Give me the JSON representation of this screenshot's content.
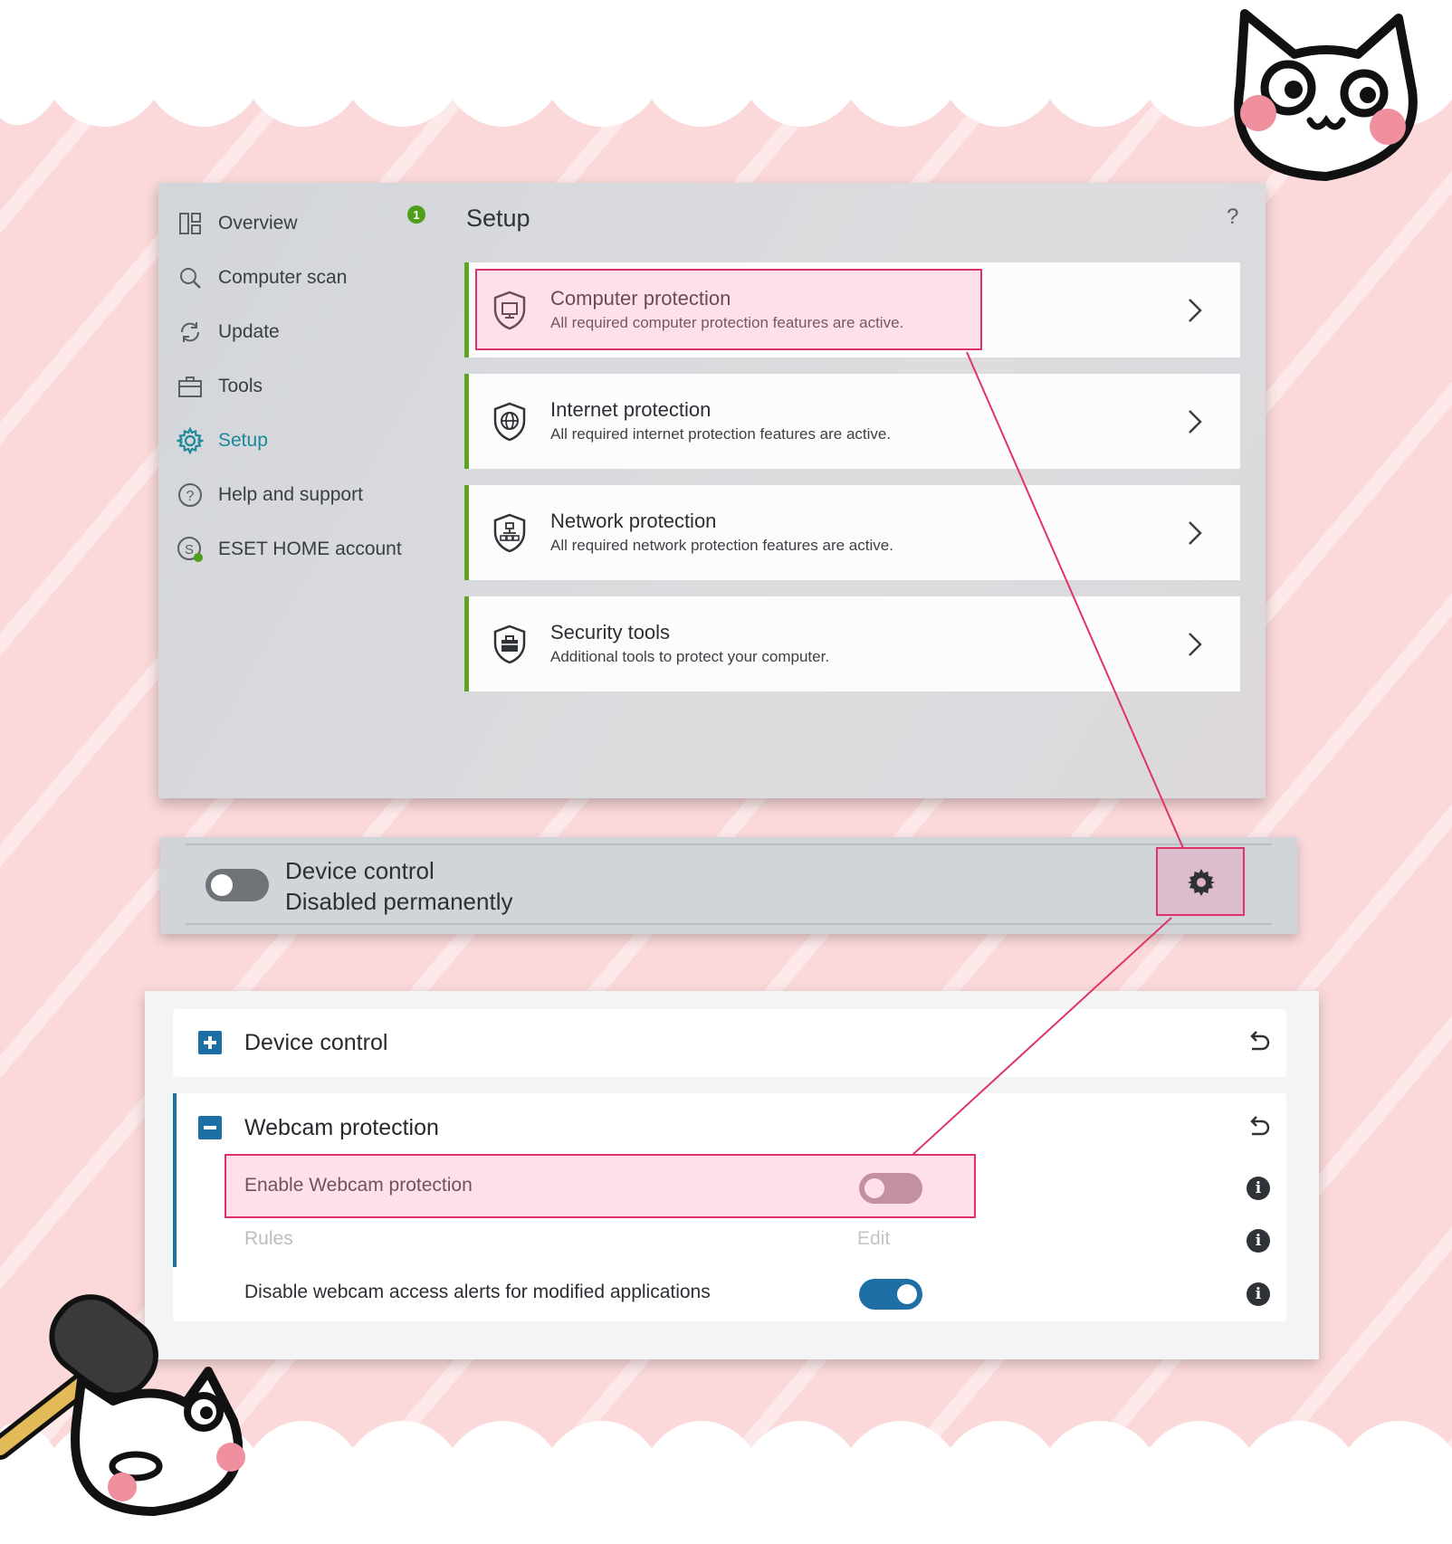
{
  "sidebar": {
    "items": [
      {
        "label": "Overview",
        "icon": "overview-icon",
        "badge": "1"
      },
      {
        "label": "Computer scan",
        "icon": "search-icon"
      },
      {
        "label": "Update",
        "icon": "refresh-icon"
      },
      {
        "label": "Tools",
        "icon": "toolbox-icon"
      },
      {
        "label": "Setup",
        "icon": "gear-icon",
        "active": true
      },
      {
        "label": "Help and support",
        "icon": "help-icon"
      },
      {
        "label": "ESET HOME account",
        "icon": "account-icon"
      }
    ]
  },
  "main": {
    "title": "Setup",
    "help": "?",
    "cards": [
      {
        "title": "Computer protection",
        "subtitle": "All required computer protection features are active.",
        "icon": "monitor-shield-icon"
      },
      {
        "title": "Internet protection",
        "subtitle": "All required internet protection features are active.",
        "icon": "globe-shield-icon"
      },
      {
        "title": "Network protection",
        "subtitle": "All required network protection features are active.",
        "icon": "network-shield-icon"
      },
      {
        "title": "Security tools",
        "subtitle": "Additional tools to protect your computer.",
        "icon": "toolbox-shield-icon"
      }
    ]
  },
  "device_control_strip": {
    "title": "Device control",
    "status": "Disabled permanently",
    "enabled": false
  },
  "advanced": {
    "device_control": {
      "title": "Device control",
      "expanded": false
    },
    "webcam": {
      "title": "Webcam protection",
      "expanded": true,
      "enable_label": "Enable Webcam protection",
      "enable_on": false,
      "rules_label": "Rules",
      "rules_action": "Edit",
      "alerts_label": "Disable webcam access alerts for modified applications",
      "alerts_on": true
    }
  },
  "colors": {
    "accent_teal": "#1a8a99",
    "card_border_green": "#5da425",
    "badge_green": "#4f9e1d",
    "highlight": "#e0326a",
    "toggle_blue": "#1e6fa6",
    "background_pink": "#fbd9da"
  }
}
